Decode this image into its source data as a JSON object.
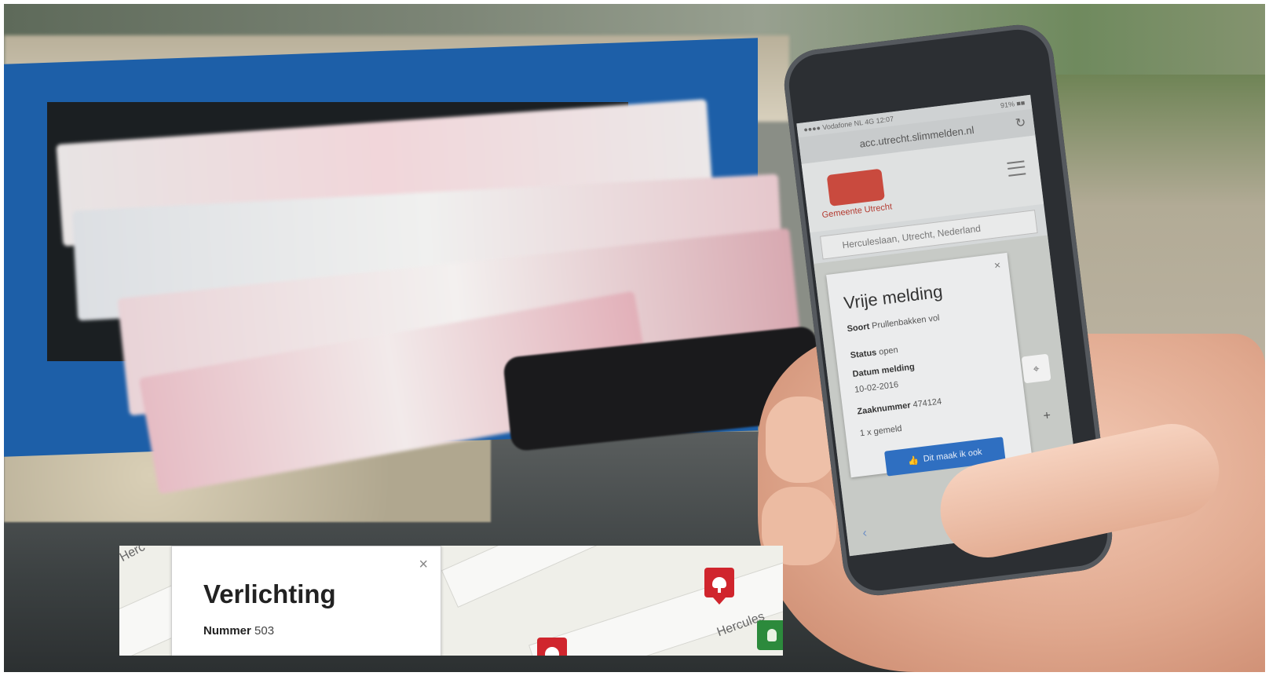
{
  "phone": {
    "status_left": "●●●● Vodafone NL  4G  12:07",
    "status_right": "91% ■■",
    "url": "acc.utrecht.slimmelden.nl",
    "logo_text": "Gemeente Utrecht",
    "address": "Herculeslaan, Utrecht, Nederland",
    "popup": {
      "title": "Vrije melding",
      "soort_label": "Soort",
      "soort_value": "Prullenbakken vol",
      "status_label": "Status",
      "status_value": "open",
      "datum_label": "Datum melding",
      "datum_value": "10-02-2016",
      "zaak_label": "Zaaknummer",
      "zaak_value": "474124",
      "gemeld": "1 x gemeld",
      "button": "Dit maak ik ook"
    }
  },
  "inset": {
    "street_top_left": "Herc",
    "street_right": "Hercules",
    "popup": {
      "title": "Verlichting",
      "nummer_label": "Nummer",
      "nummer_value": "503"
    }
  }
}
